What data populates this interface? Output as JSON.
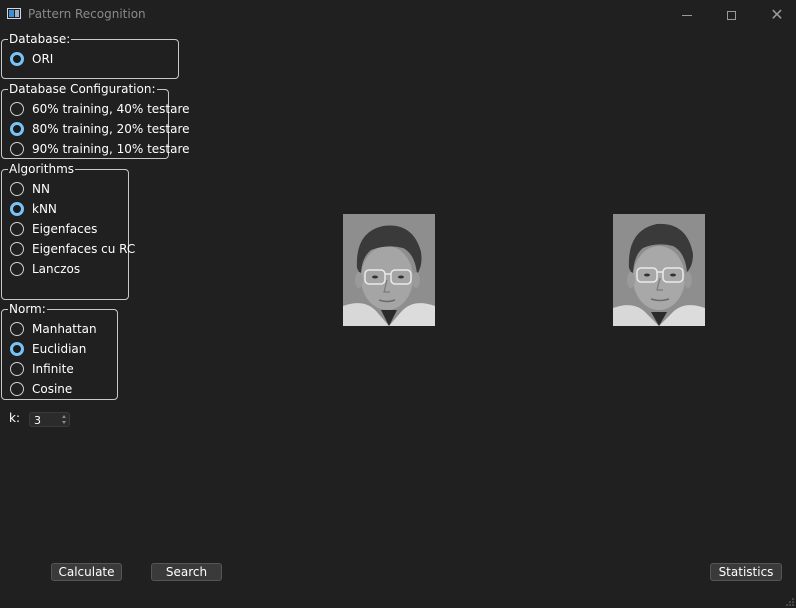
{
  "window": {
    "title": "Pattern Recognition"
  },
  "groups": {
    "database": {
      "title": "Database:",
      "options": [
        "ORI"
      ],
      "selected": 0
    },
    "config": {
      "title": "Database Configuration:",
      "options": [
        "60% training, 40% testare",
        "80% training, 20% testare",
        "90% training, 10% testare"
      ],
      "selected": 1
    },
    "algorithms": {
      "title": "Algorithms",
      "options": [
        "NN",
        "kNN",
        "Eigenfaces",
        "Eigenfaces cu RC",
        "Lanczos"
      ],
      "selected": 1
    },
    "norm": {
      "title": "Norm:",
      "options": [
        "Manhattan",
        "Euclidian",
        "Infinite",
        "Cosine"
      ],
      "selected": 1
    }
  },
  "k": {
    "label": "k:",
    "value": "3"
  },
  "buttons": {
    "calculate": "Calculate",
    "search": "Search",
    "statistics": "Statistics"
  },
  "colors": {
    "accent": "#78c3f5",
    "background": "#202020"
  }
}
